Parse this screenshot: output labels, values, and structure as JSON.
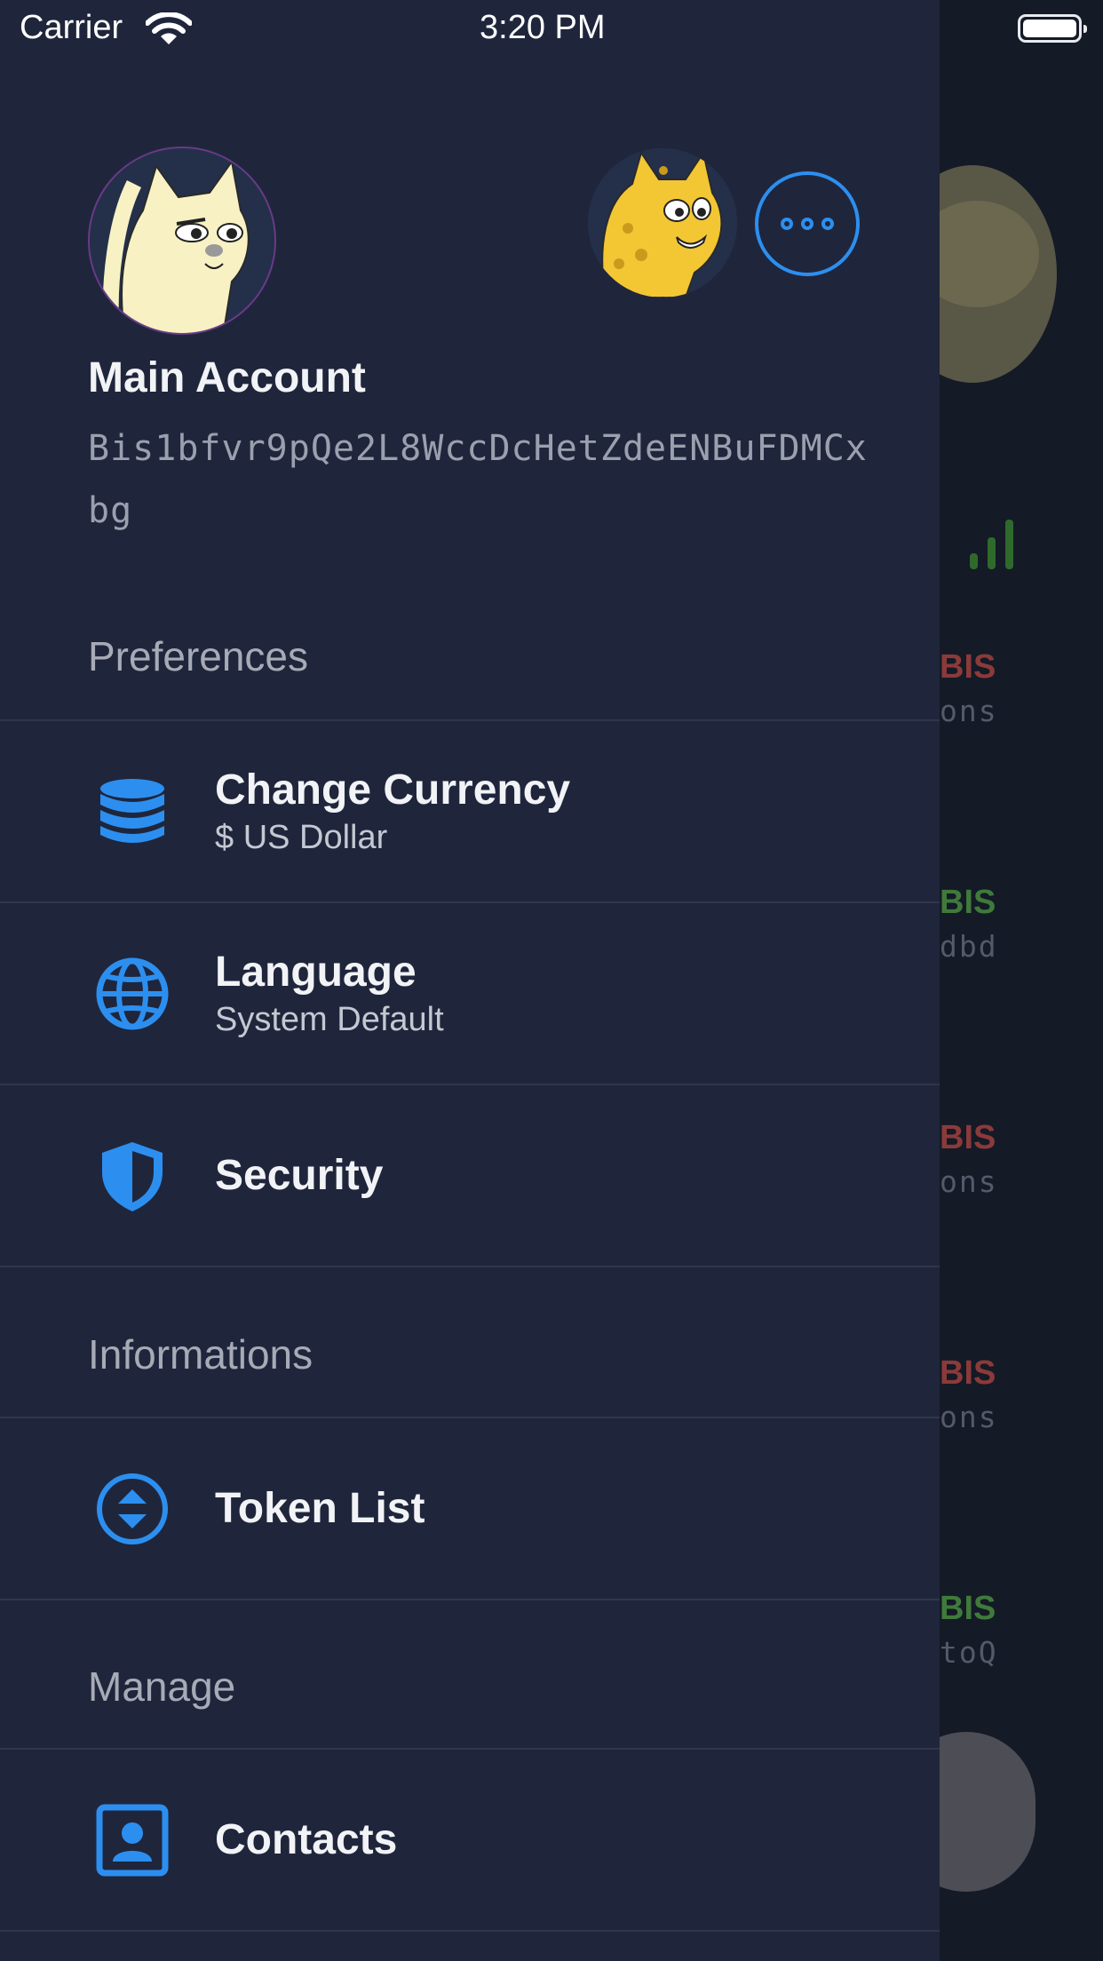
{
  "status_bar": {
    "carrier": "Carrier",
    "time": "3:20 PM"
  },
  "account": {
    "name": "Main Account",
    "address": "Bis1bfvr9pQe2L8WccDcHetZdeENBuFDMCxbg"
  },
  "sections": {
    "preferences": "Preferences",
    "informations": "Informations",
    "manage": "Manage"
  },
  "menu": {
    "change_currency": {
      "label": "Change Currency",
      "sub": "$ US Dollar",
      "icon": "database-icon"
    },
    "language": {
      "label": "Language",
      "sub": "System Default",
      "icon": "globe-icon"
    },
    "security": {
      "label": "Security",
      "icon": "shield-icon"
    },
    "token_list": {
      "label": "Token List",
      "icon": "token-swap-icon"
    },
    "contacts": {
      "label": "Contacts",
      "icon": "contact-card-icon"
    }
  },
  "background": {
    "rows": [
      {
        "amount": "BIS",
        "sub": "ons",
        "color": "#8b3a3a"
      },
      {
        "amount": "BIS",
        "sub": "dbd",
        "color": "#3f7a3b"
      },
      {
        "amount": "BIS",
        "sub": "ons",
        "color": "#8b3a3a"
      },
      {
        "amount": "BIS",
        "sub": "ons",
        "color": "#8b3a3a"
      },
      {
        "amount": "BIS",
        "sub": "toQ",
        "color": "#3f7a3b"
      }
    ]
  },
  "colors": {
    "drawer": "#1f263c",
    "accent": "#2c8ff0",
    "text": "#f2f3f6",
    "muted": "#a6abb6"
  }
}
